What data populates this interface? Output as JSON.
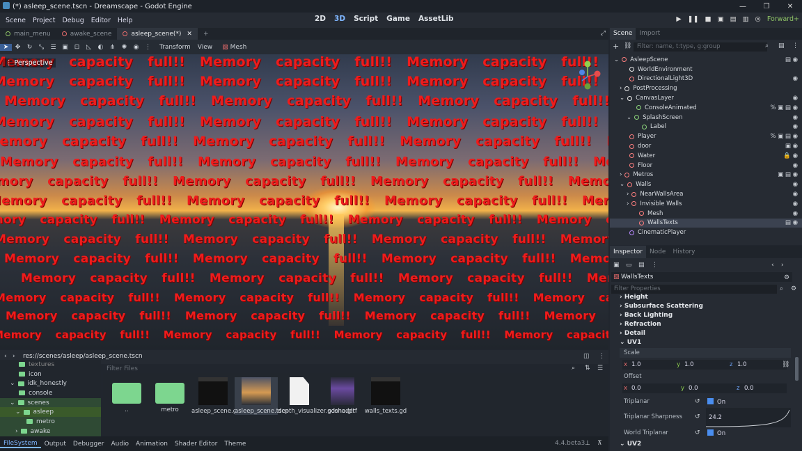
{
  "window": {
    "title": "(*) asleep_scene.tscn - Dreamscape - Godot Engine"
  },
  "menu": [
    "Scene",
    "Project",
    "Debug",
    "Editor",
    "Help"
  ],
  "workspaces": [
    "2D",
    "3D",
    "Script",
    "Game",
    "AssetLib"
  ],
  "renderer": "Forward+",
  "scene_tabs": [
    {
      "label": "main_menu"
    },
    {
      "label": "awake_scene"
    },
    {
      "label": "asleep_scene(*)"
    }
  ],
  "viewport_toolbar": {
    "transform": "Transform",
    "view": "View",
    "mesh": "Mesh"
  },
  "viewport": {
    "perspective": "Perspective",
    "overlay_text": "Memory capacity full!!"
  },
  "filesystem": {
    "path": "res://scenes/asleep/asleep_scene.tscn",
    "filter_placeholder": "Filter Files",
    "tree": [
      "textures",
      "icon",
      "idk_honestly",
      "console",
      "scenes",
      "asleep",
      "metro",
      "awake"
    ],
    "files": [
      "..",
      "metro",
      "asleep_scene.gd",
      "asleep_scene.tscn",
      "depth_visualizer.gdshader",
      "scene.gltf",
      "walls_texts.gd"
    ]
  },
  "bottom_tabs": [
    "FileSystem",
    "Output",
    "Debugger",
    "Audio",
    "Animation",
    "Shader Editor",
    "Theme"
  ],
  "version": "4.4.beta3",
  "scene_dock": {
    "tabs": [
      "Scene",
      "Import"
    ],
    "filter_placeholder": "Filter: name, t:type, g:group",
    "nodes": [
      "AsleepScene",
      "WorldEnvironment",
      "DirectionalLight3D",
      "PostProcessing",
      "CanvasLayer",
      "ConsoleAnimated",
      "SplashScreen",
      "Label",
      "Player",
      "door",
      "Water",
      "Floor",
      "Metros",
      "Walls",
      "NearWallsArea",
      "Invisible Walls",
      "Mesh",
      "WallsTexts",
      "CinematicPlayer"
    ]
  },
  "inspector": {
    "tabs": [
      "Inspector",
      "Node",
      "History"
    ],
    "object": "WallsTexts",
    "filter_placeholder": "Filter Properties",
    "sections": [
      "Height",
      "Subsurface Scattering",
      "Back Lighting",
      "Refraction",
      "Detail",
      "UV1"
    ],
    "scale_label": "Scale",
    "scale": {
      "x": "1.0",
      "y": "1.0",
      "z": "1.0"
    },
    "offset_label": "Offset",
    "offset": {
      "x": "0.0",
      "y": "0.0",
      "z": "0.0"
    },
    "triplanar_label": "Triplanar",
    "triplanar_value": "On",
    "sharpness_label": "Triplanar Sharpness",
    "sharpness_value": "24.2",
    "world_triplanar_label": "World Triplanar",
    "world_triplanar_value": "On",
    "uv2": "UV2"
  }
}
